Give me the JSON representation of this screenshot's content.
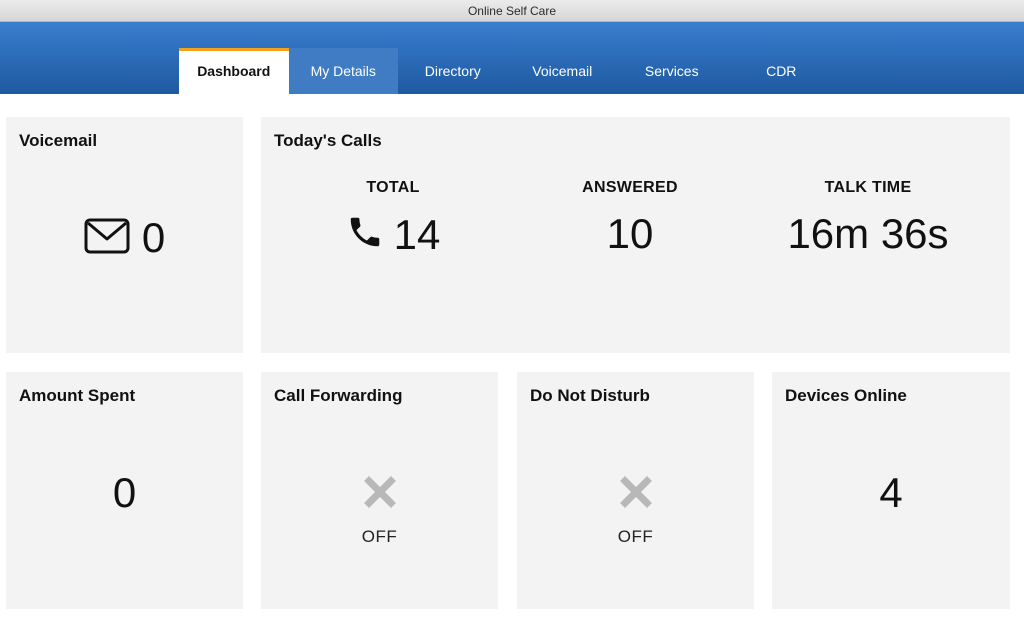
{
  "window": {
    "title": "Online Self Care"
  },
  "nav": {
    "tabs": [
      {
        "label": "Dashboard",
        "active": true
      },
      {
        "label": "My Details",
        "active": false
      },
      {
        "label": "Directory",
        "active": false
      },
      {
        "label": "Voicemail",
        "active": false
      },
      {
        "label": "Services",
        "active": false
      },
      {
        "label": "CDR",
        "active": false
      }
    ]
  },
  "colors": {
    "accent": "#f5a21b",
    "header": "#2a69b5",
    "card_bg": "#f3f3f3",
    "off_icon": "#b8b8b8"
  },
  "voicemail": {
    "title": "Voicemail",
    "icon": "envelope-icon",
    "count": "0"
  },
  "todays_calls": {
    "title": "Today's Calls",
    "total": {
      "label": "TOTAL",
      "icon": "phone-icon",
      "value": "14"
    },
    "answered": {
      "label": "ANSWERED",
      "value": "10"
    },
    "talk_time": {
      "label": "TALK TIME",
      "value": "16m 36s"
    }
  },
  "amount_spent": {
    "title": "Amount Spent",
    "value": "0"
  },
  "call_forwarding": {
    "title": "Call Forwarding",
    "icon": "x-icon",
    "status": "OFF"
  },
  "do_not_disturb": {
    "title": "Do Not Disturb",
    "icon": "x-icon",
    "status": "OFF"
  },
  "devices_online": {
    "title": "Devices Online",
    "value": "4"
  }
}
